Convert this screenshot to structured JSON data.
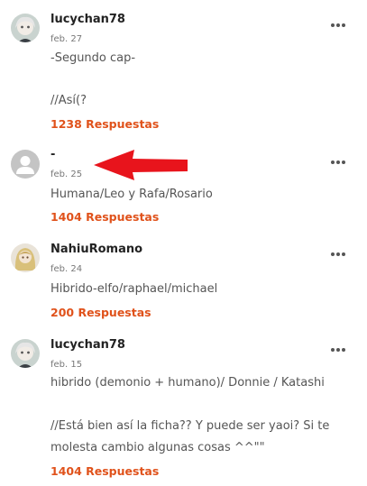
{
  "comments": [
    {
      "username": "lucychan78",
      "date": "feb. 27",
      "lines": [
        "-Segundo cap-",
        "",
        "//Así(?"
      ],
      "replies": "1238 Respuestas",
      "avatar": "anime-avatar-icon"
    },
    {
      "username": "-",
      "date": "feb. 25",
      "lines": [
        "Humana/Leo y Rafa/Rosario"
      ],
      "replies": "1404 Respuestas",
      "avatar": "default-user-icon"
    },
    {
      "username": "NahiuRomano",
      "date": "feb. 24",
      "lines": [
        "Hibrido-elfo/raphael/michael"
      ],
      "replies": "200 Respuestas",
      "avatar": "blonde-avatar-icon"
    },
    {
      "username": "lucychan78",
      "date": "feb. 15",
      "lines": [
        "hibrido (demonio + humano)/ Donnie / Katashi",
        "",
        "//Está bien así la ficha?? Y puede ser yaoi? Si te",
        "molesta cambio algunas cosas ^^\"\""
      ],
      "replies": "1404 Respuestas",
      "avatar": "anime-avatar-icon"
    }
  ],
  "colors": {
    "accent": "#e0521b",
    "annotation_arrow": "#e8141c"
  },
  "icons": {
    "more": "more-options-icon",
    "arrow": "red-arrow-icon"
  }
}
